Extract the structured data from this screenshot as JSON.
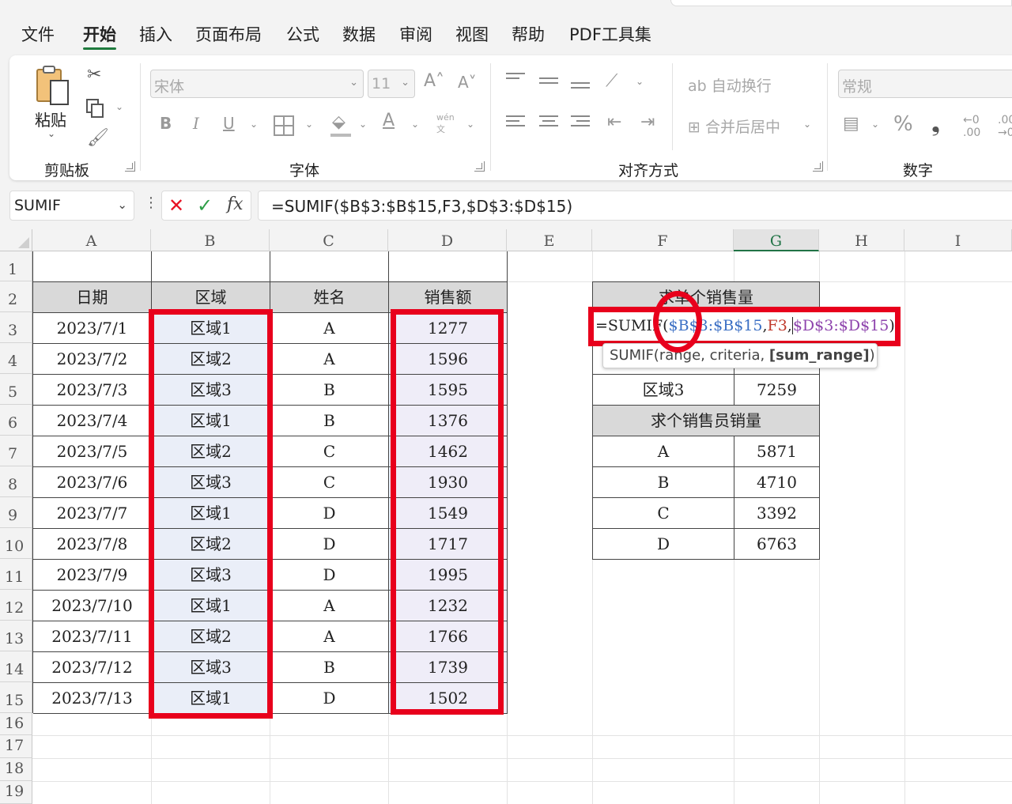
{
  "menu": {
    "tabs": [
      "文件",
      "开始",
      "插入",
      "页面布局",
      "公式",
      "数据",
      "审阅",
      "视图",
      "帮助",
      "PDF工具集"
    ],
    "active": "开始"
  },
  "ribbon": {
    "clipboard": {
      "paste_label": "粘贴",
      "group_label": "剪贴板"
    },
    "font": {
      "font_name": "宋体",
      "font_size": "11",
      "bold": "B",
      "italic": "I",
      "underline": "U",
      "group_label": "字体",
      "phonetic_top": "wén",
      "phonetic_bottom": "文"
    },
    "alignment": {
      "wrap_text": "自动换行",
      "merge_center": "合并后居中",
      "group_label": "对齐方式"
    },
    "number": {
      "format": "常规",
      "percent": "%",
      "comma": "❟",
      "group_label": "数字"
    }
  },
  "formula_bar": {
    "name_box": "SUMIF",
    "cancel": "✕",
    "enter": "✓",
    "fx": "fx",
    "formula": "=SUMIF($B$3:$B$15,F3,$D$3:$D$15)"
  },
  "grid": {
    "columns": [
      "A",
      "B",
      "C",
      "D",
      "E",
      "F",
      "G",
      "H",
      "I"
    ],
    "rows": [
      "1",
      "2",
      "3",
      "4",
      "5",
      "6",
      "7",
      "8",
      "9",
      "10",
      "11",
      "12",
      "13",
      "14",
      "15",
      "16",
      "17",
      "18",
      "19"
    ],
    "table_headers": [
      "日期",
      "区域",
      "姓名",
      "销售额"
    ],
    "table_rows": [
      [
        "2023/7/1",
        "区域1",
        "A",
        "1277"
      ],
      [
        "2023/7/2",
        "区域2",
        "A",
        "1596"
      ],
      [
        "2023/7/3",
        "区域3",
        "B",
        "1595"
      ],
      [
        "2023/7/4",
        "区域1",
        "B",
        "1376"
      ],
      [
        "2023/7/5",
        "区域2",
        "C",
        "1462"
      ],
      [
        "2023/7/6",
        "区域3",
        "C",
        "1930"
      ],
      [
        "2023/7/7",
        "区域1",
        "D",
        "1549"
      ],
      [
        "2023/7/8",
        "区域2",
        "D",
        "1717"
      ],
      [
        "2023/7/9",
        "区域3",
        "D",
        "1995"
      ],
      [
        "2023/7/10",
        "区域1",
        "A",
        "1232"
      ],
      [
        "2023/7/11",
        "区域2",
        "A",
        "1766"
      ],
      [
        "2023/7/12",
        "区域3",
        "B",
        "1739"
      ],
      [
        "2023/7/13",
        "区域1",
        "D",
        "1502"
      ]
    ],
    "region_title": "求单个销售量",
    "region_visible": [
      "区域3",
      "7259"
    ],
    "person_title": "求个销售员销量",
    "person_rows": [
      [
        "A",
        "5871"
      ],
      [
        "B",
        "4710"
      ],
      [
        "C",
        "3392"
      ],
      [
        "D",
        "6763"
      ]
    ],
    "edit_formula": {
      "prefix": "=SUMIF(",
      "range1": "$B$3:$B$15",
      "sep1": ",",
      "crit": "F3",
      "sep2": ",",
      "range2": "$D$3:$D$15",
      "suffix": ")"
    },
    "tooltip": {
      "fn": "SUMIF(",
      "args": "range, criteria, ",
      "bold_arg": "[sum_range]",
      "end": ")"
    }
  },
  "colors": {
    "accent": "#217346",
    "highlight_red": "#e8001c",
    "ref_blue": "#3b6fc4",
    "ref_red": "#c0392b",
    "ref_purple": "#8e44ad"
  }
}
